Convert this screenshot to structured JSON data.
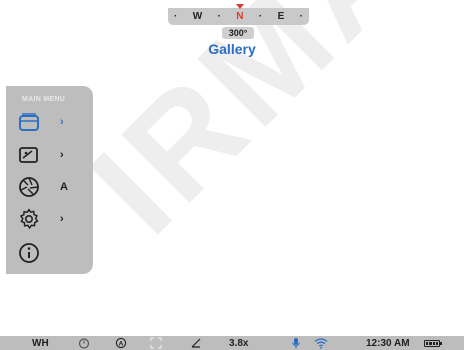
{
  "watermark": "IRMAN",
  "compass": {
    "ticks": [
      "·",
      "W",
      "·",
      "N",
      "·",
      "E",
      "·"
    ],
    "heading": "300°"
  },
  "page": {
    "title": "Gallery"
  },
  "menu": {
    "title": "MAIN MENU",
    "items": [
      {
        "icon": "gallery-icon",
        "label": "›"
      },
      {
        "icon": "image-mode-icon",
        "label": "›"
      },
      {
        "icon": "aperture-icon",
        "label": "A"
      },
      {
        "icon": "settings-gear-icon",
        "label": "›"
      },
      {
        "icon": "info-icon",
        "label": ""
      }
    ]
  },
  "status": {
    "palette": "WH",
    "zoom": "3.8x",
    "time": "12:30 AM"
  },
  "colors": {
    "accent": "#2a6fc4",
    "north": "#e03a2f",
    "panel": "#bdbdbd"
  }
}
